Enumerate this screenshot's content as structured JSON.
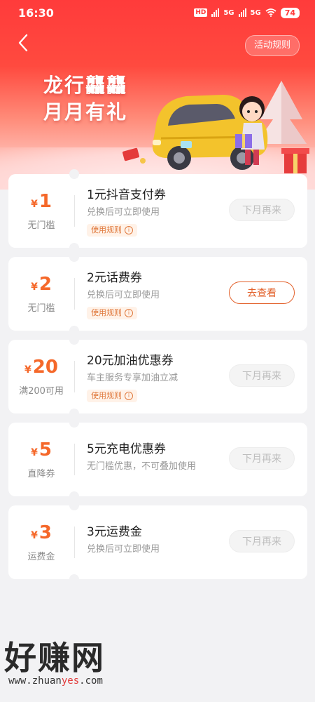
{
  "status_bar": {
    "time": "16:30",
    "hd": "HD",
    "net1": "5G",
    "net2": "5G",
    "battery": "74"
  },
  "header": {
    "rules_label": "活动规则"
  },
  "hero": {
    "title_line1": "龙行龘龘",
    "title_line2": "月月有礼"
  },
  "currency_symbol": "¥",
  "rule_tag_label": "使用规则",
  "coupons": [
    {
      "amount": "1",
      "condition": "无门槛",
      "title": "1元抖音支付券",
      "desc": "兑换后可立即使用",
      "has_rule": true,
      "button": "下月再来",
      "button_state": "disabled"
    },
    {
      "amount": "2",
      "condition": "无门槛",
      "title": "2元话费券",
      "desc": "兑换后可立即使用",
      "has_rule": true,
      "button": "去查看",
      "button_state": "active"
    },
    {
      "amount": "20",
      "condition": "满200可用",
      "title": "20元加油优惠券",
      "desc": "车主服务专享加油立减",
      "has_rule": true,
      "button": "下月再来",
      "button_state": "disabled"
    },
    {
      "amount": "5",
      "condition": "直降券",
      "title": "5元充电优惠券",
      "desc": "无门槛优惠，不可叠加使用",
      "has_rule": false,
      "button": "下月再来",
      "button_state": "disabled"
    },
    {
      "amount": "3",
      "condition": "运费金",
      "title": "3元运费金",
      "desc": "兑换后可立即使用",
      "has_rule": false,
      "button": "下月再来",
      "button_state": "disabled"
    }
  ],
  "watermark": {
    "main": "好赚网",
    "url_a": "www.zhuan",
    "url_b": "yes",
    "url_c": ".com"
  },
  "colors": {
    "accent": "#f5682a",
    "hero_red": "#ff3b3b",
    "button_active": "#e2602a"
  }
}
